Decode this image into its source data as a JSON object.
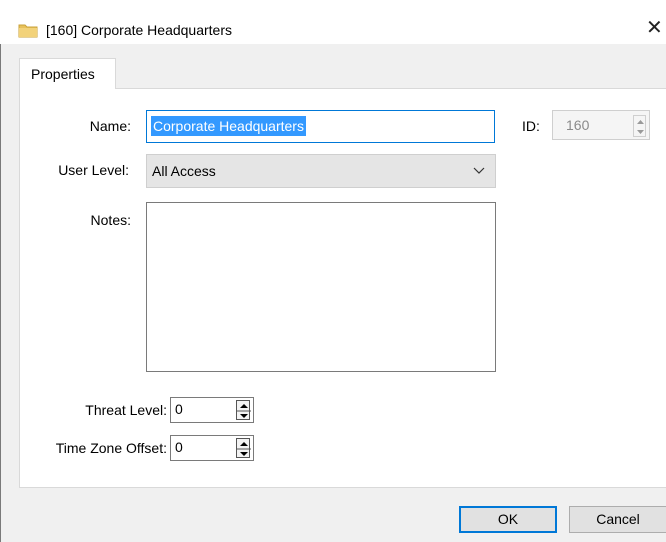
{
  "window": {
    "title": "[160] Corporate Headquarters",
    "close_glyph": "✕",
    "icon": "folder-icon"
  },
  "tabs": [
    {
      "label": "Properties",
      "selected": true
    }
  ],
  "form": {
    "name_label": "Name:",
    "name_value": "Corporate Headquarters",
    "id_label": "ID:",
    "id_value": "160",
    "user_level_label": "User Level:",
    "user_level_value": "All Access",
    "notes_label": "Notes:",
    "notes_value": "",
    "threat_level_label": "Threat Level:",
    "threat_level_value": "0",
    "tz_offset_label": "Time Zone Offset:",
    "tz_offset_value": "0"
  },
  "buttons": {
    "ok": "OK",
    "cancel": "Cancel"
  },
  "colors": {
    "accent": "#0078d7",
    "selection": "#3399ff",
    "folder": "#e8c15a"
  }
}
